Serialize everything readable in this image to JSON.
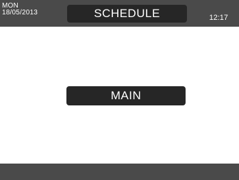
{
  "header": {
    "day": "MON",
    "date": "18/05/2013",
    "title": "SCHEDULE",
    "time": "12:17"
  },
  "main": {
    "button_label": "MAIN"
  },
  "colors": {
    "bar_background": "#4a4a4a",
    "button_background": "#262626",
    "text": "#ffffff",
    "screen_background": "#ffffff"
  }
}
